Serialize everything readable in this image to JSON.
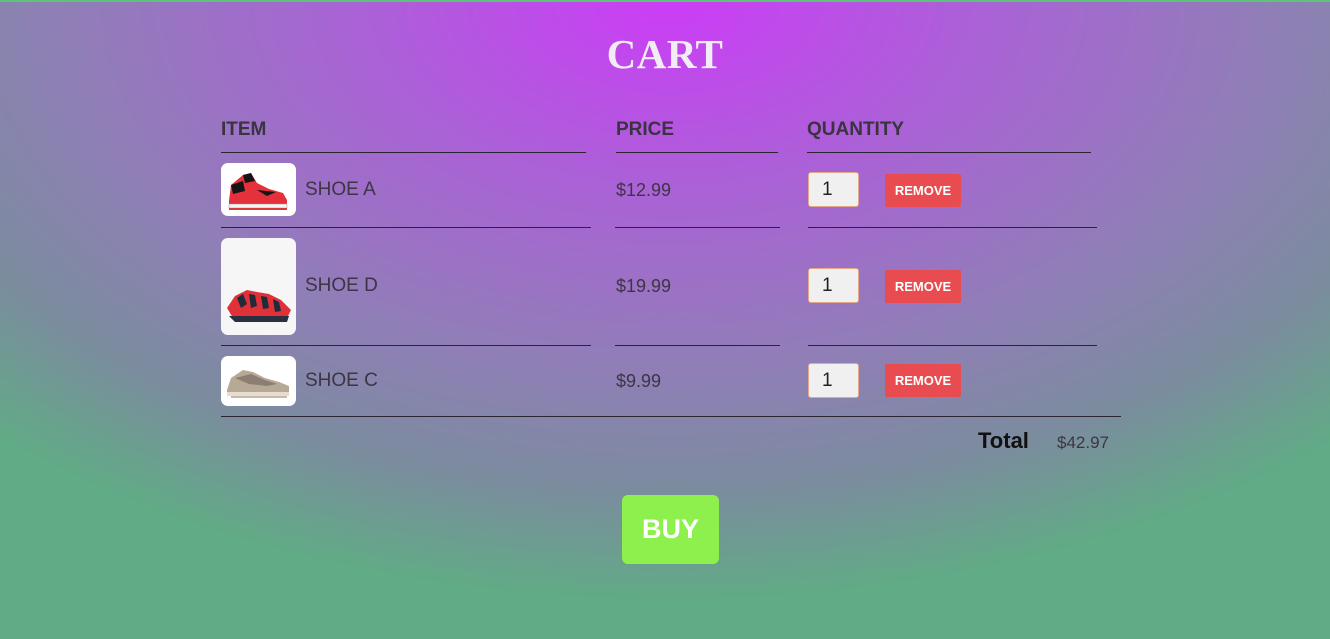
{
  "cart": {
    "title": "CART",
    "headers": {
      "item": "ITEM",
      "price": "PRICE",
      "quantity": "QUANTITY"
    },
    "items": [
      {
        "name": "SHOE A",
        "price": "$12.99",
        "quantity": "1",
        "remove_label": "REMOVE",
        "image": "red-black-high-top-sneaker"
      },
      {
        "name": "SHOE D",
        "price": "$19.99",
        "quantity": "1",
        "remove_label": "REMOVE",
        "image": "red-running-shoe"
      },
      {
        "name": "SHOE C",
        "price": "$9.99",
        "quantity": "1",
        "remove_label": "REMOVE",
        "image": "beige-knit-sneaker"
      }
    ],
    "total_label": "Total",
    "total_value": "$42.97",
    "buy_label": "BUY"
  },
  "colors": {
    "remove_button": "#e84c50",
    "buy_button": "#8ef04d",
    "title_text": "#f2ecf5"
  }
}
